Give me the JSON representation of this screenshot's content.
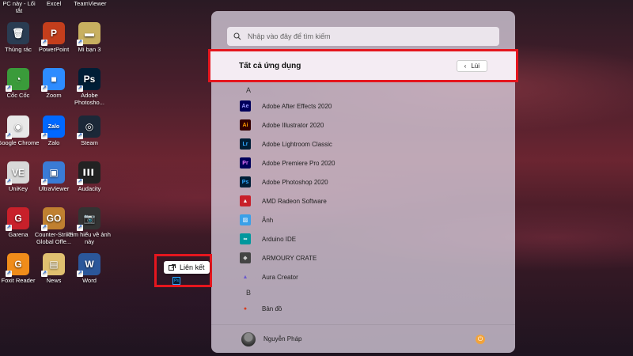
{
  "desktop": {
    "top_labels": [
      "PC này - Lối tắt",
      "Excel",
      "TeamViewer"
    ],
    "icons": [
      {
        "label": "Thùng rác",
        "color": "#2a3c52",
        "glyph": "🗑"
      },
      {
        "label": "PowerPoint",
        "color": "#c43e1c",
        "glyph": "P"
      },
      {
        "label": "Mi bạn 3",
        "color": "#c8b060",
        "glyph": "▬"
      },
      {
        "label": "Cốc Cốc",
        "color": "#3a9b3a",
        "glyph": "◔"
      },
      {
        "label": "Zoom",
        "color": "#2d8cff",
        "glyph": "■"
      },
      {
        "label": "Adobe Photosho...",
        "color": "#001e36",
        "glyph": "Ps"
      },
      {
        "label": "Google Chrome",
        "color": "#e8e8e8",
        "glyph": "◉"
      },
      {
        "label": "Zalo",
        "color": "#0068ff",
        "glyph": "Zalo"
      },
      {
        "label": "Steam",
        "color": "#1b2838",
        "glyph": "◎"
      },
      {
        "label": "UniKey",
        "color": "#d8d8d8",
        "glyph": "VE"
      },
      {
        "label": "UltraViewer",
        "color": "#3a7bd5",
        "glyph": "▣"
      },
      {
        "label": "Audacity",
        "color": "#222",
        "glyph": "▌▌▌"
      },
      {
        "label": "Garena",
        "color": "#c8202a",
        "glyph": "G"
      },
      {
        "label": "Counter-Strike Global Offe...",
        "color": "#c08030",
        "glyph": "GO"
      },
      {
        "label": "Tìm hiểu về ảnh này",
        "color": "#333",
        "glyph": "📷"
      },
      {
        "label": "Foxit Reader",
        "color": "#f08c1a",
        "glyph": "G"
      },
      {
        "label": "News",
        "color": "#e0c070",
        "glyph": "▤"
      },
      {
        "label": "Word",
        "color": "#2b579a",
        "glyph": "W"
      }
    ]
  },
  "start_menu": {
    "search_placeholder": "Nhập vào đây để tìm kiếm",
    "section_title": "Tất cả ứng dụng",
    "back_label": "Lùi",
    "groups": [
      {
        "letter": "A",
        "apps": [
          {
            "name": "Adobe After Effects 2020",
            "abbr": "Ae",
            "bg": "#00005b",
            "fg": "#9999ff"
          },
          {
            "name": "Adobe Illustrator 2020",
            "abbr": "Ai",
            "bg": "#330000",
            "fg": "#ff9a00"
          },
          {
            "name": "Adobe Lightroom Classic",
            "abbr": "Lr",
            "bg": "#001e36",
            "fg": "#31a8ff"
          },
          {
            "name": "Adobe Premiere Pro 2020",
            "abbr": "Pr",
            "bg": "#00005b",
            "fg": "#ea77ff"
          },
          {
            "name": "Adobe Photoshop 2020",
            "abbr": "Ps",
            "bg": "#001e36",
            "fg": "#31a8ff"
          },
          {
            "name": "AMD Radeon Software",
            "abbr": "▲",
            "bg": "#c8202a",
            "fg": "#ffffff"
          },
          {
            "name": "Ảnh",
            "abbr": "▨",
            "bg": "#3aa0e8",
            "fg": "#ffffff"
          },
          {
            "name": "Arduino IDE",
            "abbr": "∞",
            "bg": "#00979d",
            "fg": "#ffffff"
          },
          {
            "name": "ARMOURY CRATE",
            "abbr": "◆",
            "bg": "#444444",
            "fg": "#cccccc"
          },
          {
            "name": "Aura Creator",
            "abbr": "▲",
            "bg": "transparent",
            "fg": "#6a5acd"
          }
        ]
      },
      {
        "letter": "B",
        "apps": [
          {
            "name": "Bản đồ",
            "abbr": "●",
            "bg": "transparent",
            "fg": "#d83b1e"
          }
        ]
      }
    ],
    "user_name": "Nguyễn Pháp"
  },
  "drag_popup": {
    "label": "Liên kết"
  }
}
